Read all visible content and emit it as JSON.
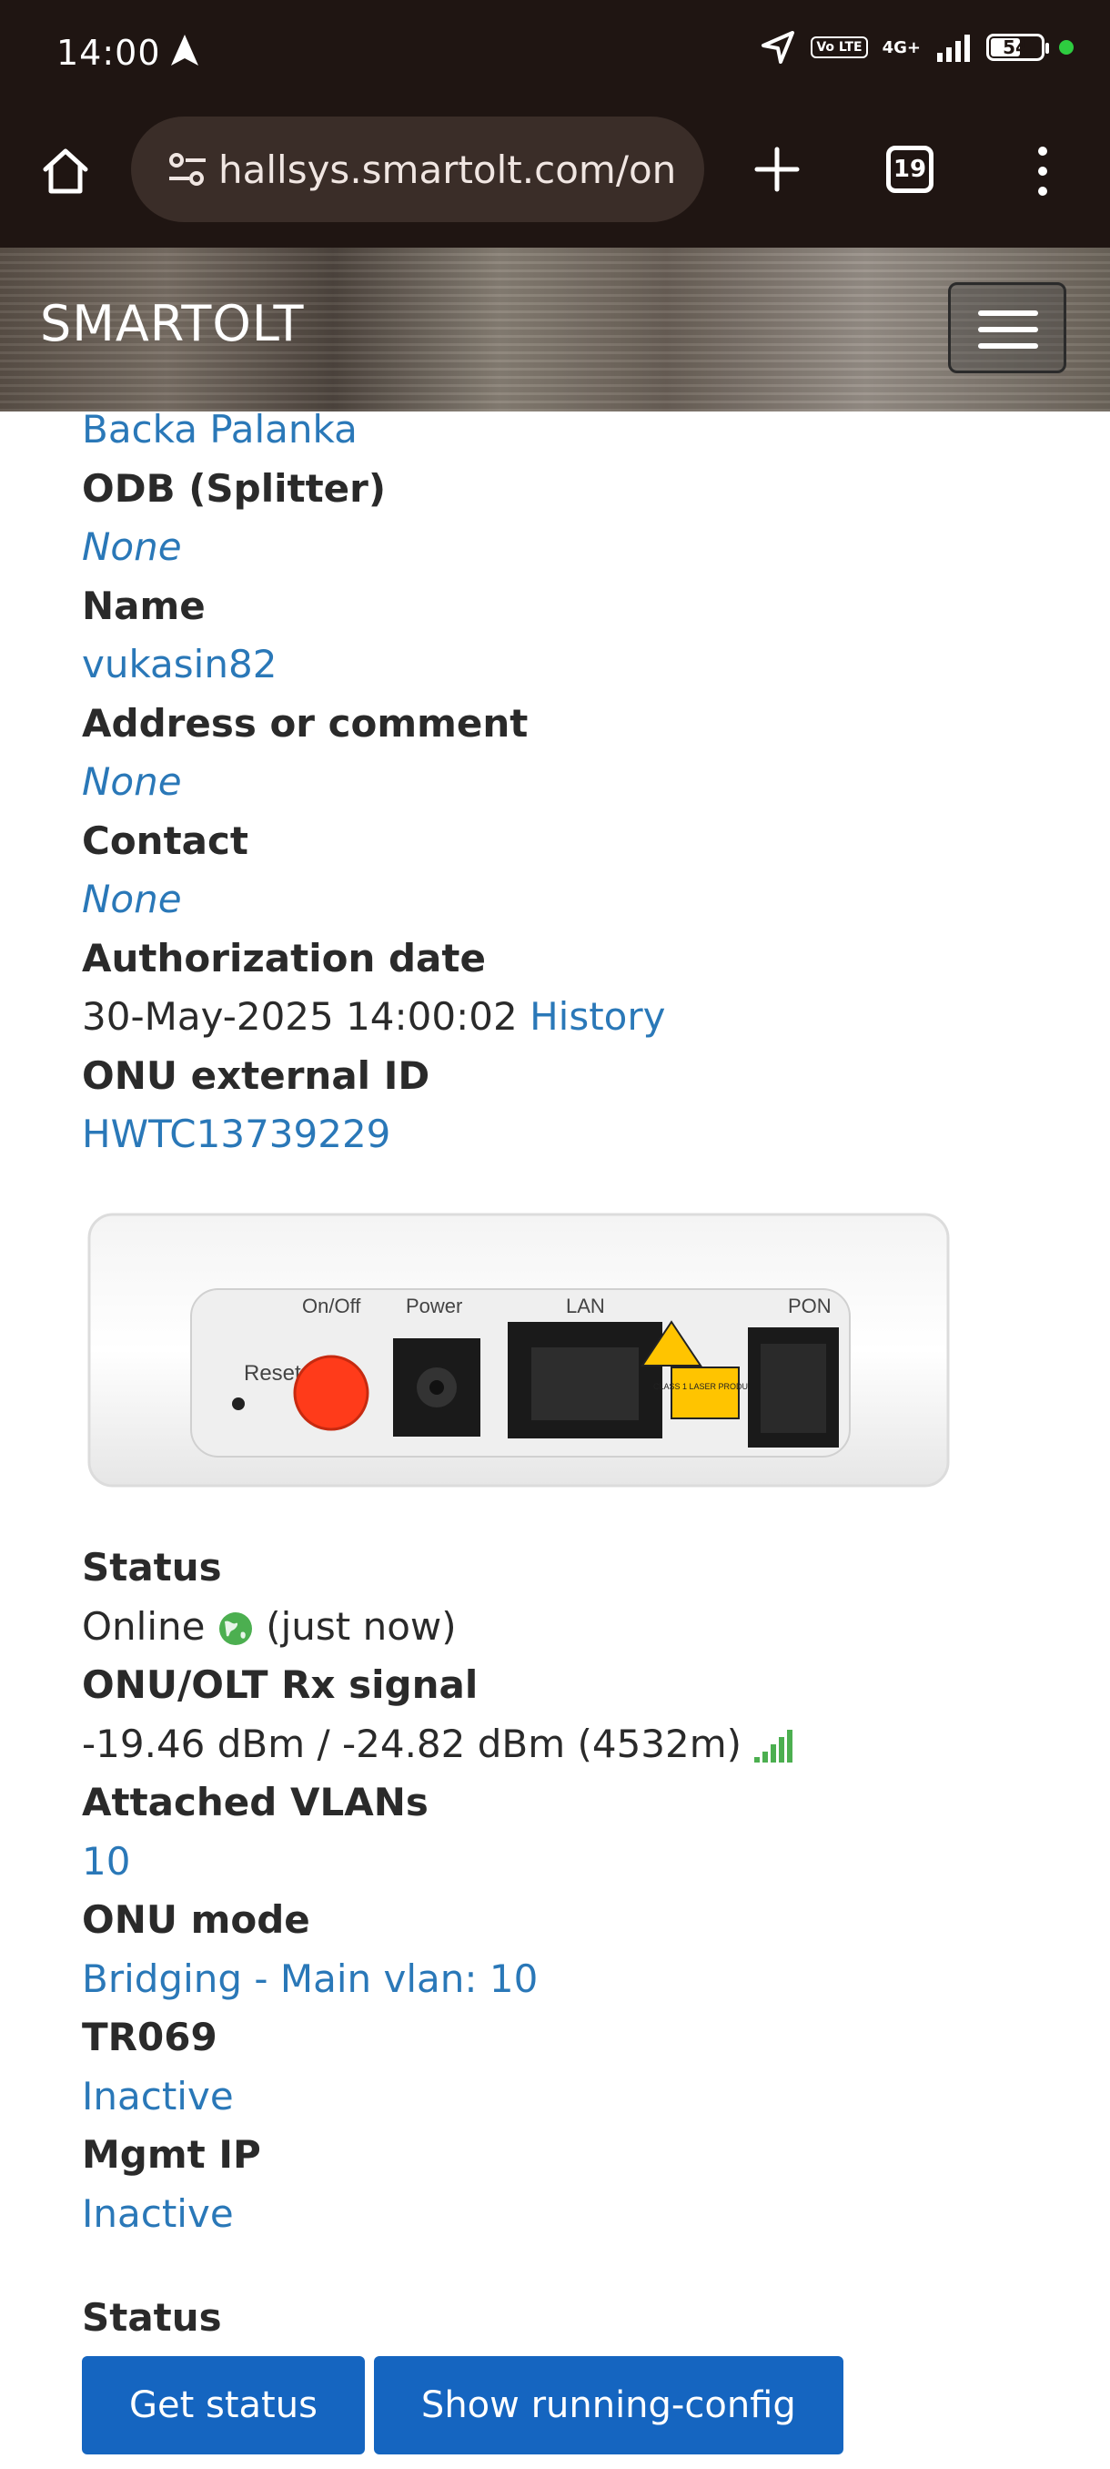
{
  "status_bar": {
    "time": "14:00",
    "network": "4G+",
    "volte": "Vo LTE",
    "battery": "54"
  },
  "browser": {
    "url": "hallsys.smartolt.com/on",
    "tab_count": "19"
  },
  "site": {
    "brand": "SMARTOLT"
  },
  "details": {
    "location_value": "Backa Palanka",
    "odb_label": "ODB (Splitter)",
    "odb_value": "None",
    "name_label": "Name",
    "name_value": "vukasin82",
    "address_label": "Address or comment",
    "address_value": "None",
    "contact_label": "Contact",
    "contact_value": "None",
    "auth_label": "Authorization date",
    "auth_value": "30-May-2025 14:00:02",
    "auth_history": "History",
    "extid_label": "ONU external ID",
    "extid_value": "HWTC13739229"
  },
  "device_image": {
    "labels": {
      "reset": "Reset",
      "onoff": "On/Off",
      "power": "Power",
      "lan": "LAN",
      "pon": "PON",
      "laser": "CLASS 1 LASER PRODUCT"
    }
  },
  "status": {
    "status_label": "Status",
    "status_value": "Online",
    "status_time": "(just now)",
    "signal_label": "ONU/OLT Rx signal",
    "signal_value": "-19.46 dBm / -24.82 dBm (4532m)",
    "vlans_label": "Attached VLANs",
    "vlans_value": "10",
    "mode_label": "ONU mode",
    "mode_value": "Bridging - Main vlan: 10",
    "tr069_label": "TR069",
    "tr069_value": "Inactive",
    "mgmt_label": "Mgmt IP",
    "mgmt_value": "Inactive",
    "section_label": "Status"
  },
  "buttons": {
    "get_status": "Get status",
    "show_config": "Show running-config"
  },
  "colors": {
    "link": "#2a78b8",
    "button": "#1565c0",
    "online": "#4caf50"
  }
}
